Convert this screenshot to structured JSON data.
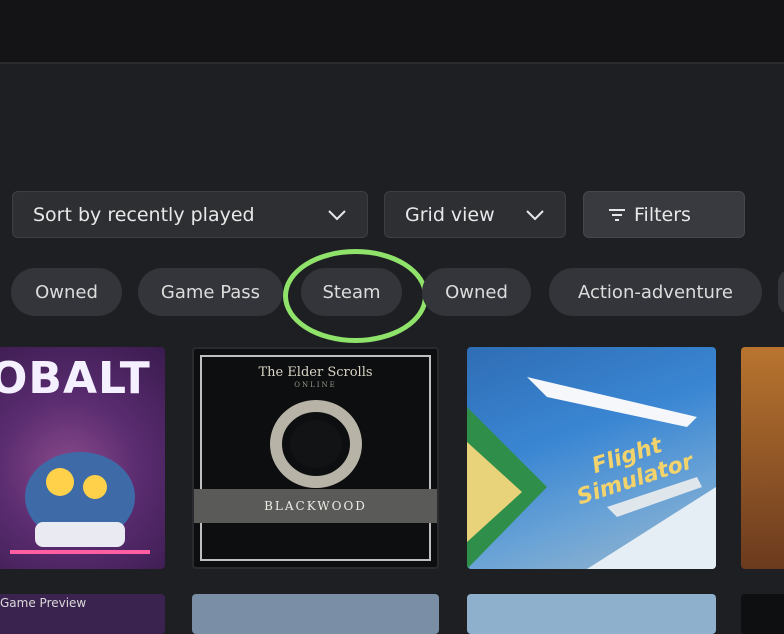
{
  "toolbar": {
    "sort_label": "Sort by recently played",
    "view_label": "Grid view",
    "filters_label": "Filters"
  },
  "chips": [
    {
      "label": "Owned"
    },
    {
      "label": "Game Pass"
    },
    {
      "label": "Steam",
      "highlighted": true
    },
    {
      "label": "Owned"
    },
    {
      "label": "Action-adventure"
    }
  ],
  "games": [
    {
      "title": "OBALT"
    },
    {
      "title": "The Elder Scrolls",
      "subtitle": "ONLINE",
      "banner": "BLACKWOOD"
    },
    {
      "title": "Flight Simulator"
    }
  ],
  "bottom_row": {
    "label": "Game Preview"
  },
  "colors": {
    "highlight": "#8fe36a",
    "background": "#1e1f22",
    "chip": "#34353a"
  }
}
